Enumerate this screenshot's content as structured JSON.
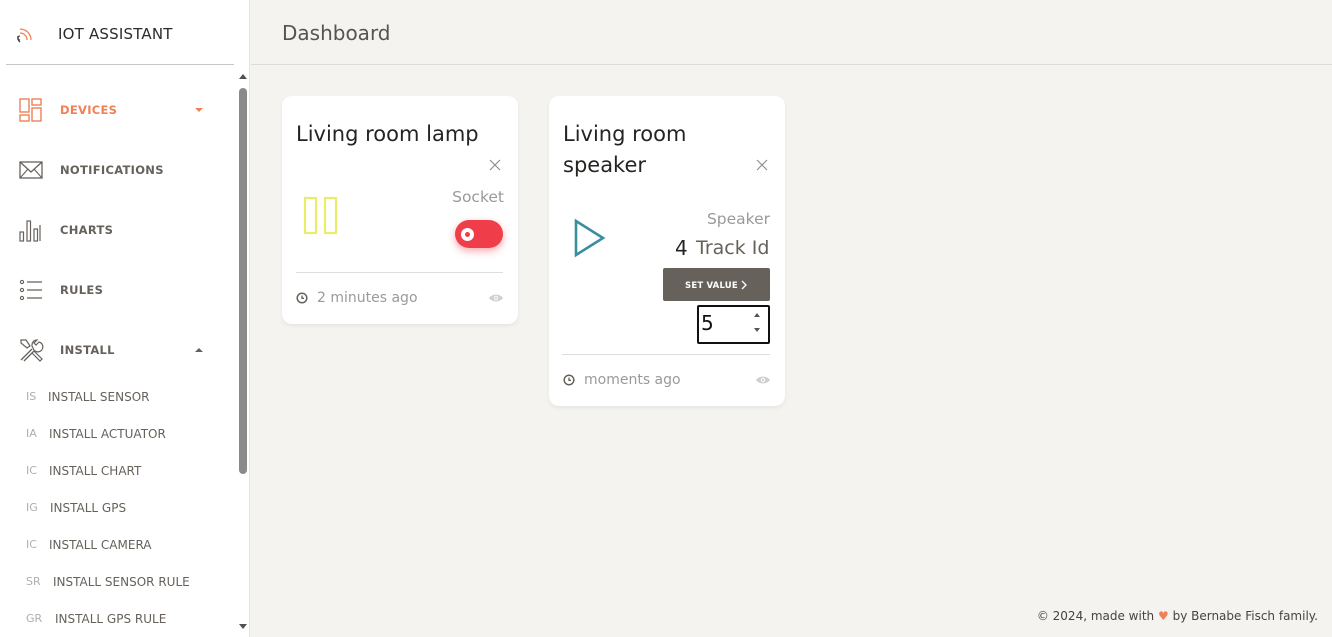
{
  "app": {
    "title": "IOT ASSISTANT"
  },
  "sidebar": {
    "items": [
      {
        "label": "DEVICES",
        "icon": "devices-grid-icon",
        "active": true,
        "caret": "down"
      },
      {
        "label": "NOTIFICATIONS",
        "icon": "envelope-icon"
      },
      {
        "label": "CHARTS",
        "icon": "bar-chart-icon"
      },
      {
        "label": "RULES",
        "icon": "list-icon"
      },
      {
        "label": "INSTALL",
        "icon": "tools-icon",
        "caret": "up"
      }
    ],
    "install_items": [
      {
        "abbr": "IS",
        "label": "INSTALL SENSOR"
      },
      {
        "abbr": "IA",
        "label": "INSTALL ACTUATOR"
      },
      {
        "abbr": "IC",
        "label": "INSTALL CHART"
      },
      {
        "abbr": "IG",
        "label": "INSTALL GPS"
      },
      {
        "abbr": "IC",
        "label": "INSTALL CAMERA"
      },
      {
        "abbr": "SR",
        "label": "INSTALL SENSOR RULE"
      },
      {
        "abbr": "GR",
        "label": "INSTALL GPS RULE"
      }
    ]
  },
  "header": {
    "title": "Dashboard"
  },
  "cards": [
    {
      "title": "Living room lamp",
      "type": "Socket",
      "icon": "pause-icon",
      "toggle_on": true,
      "time": "2 minutes ago"
    },
    {
      "title_line1": "Living room",
      "title_line2": "speaker",
      "type": "Speaker",
      "icon": "play-icon",
      "value": "4",
      "value_label": "Track Id",
      "button_label": "SET VALUE",
      "input_value": "5",
      "time": "moments ago"
    }
  ],
  "footer": {
    "prefix": "© 2024, made with",
    "heart": "♥",
    "suffix": "by Bernabe Fisch family."
  },
  "colors": {
    "accent": "#ef8157",
    "toggle": "#ef3e4a",
    "pause_icon": "#e8ee6a",
    "play_icon": "#3a8f9e",
    "button": "#66615b"
  }
}
